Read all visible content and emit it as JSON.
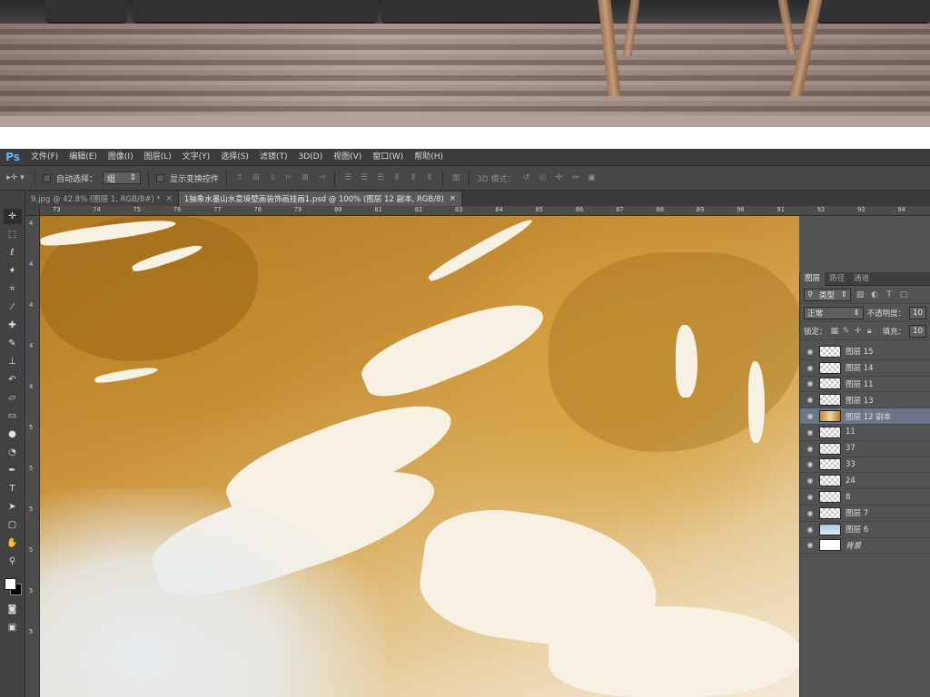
{
  "app": {
    "logo": "Ps",
    "menu": [
      "文件(F)",
      "编辑(E)",
      "图像(I)",
      "图层(L)",
      "文字(Y)",
      "选择(S)",
      "滤镜(T)",
      "3D(D)",
      "视图(V)",
      "窗口(W)",
      "帮助(H)"
    ]
  },
  "options_bar": {
    "auto_select_label": "自动选择：",
    "auto_select_value": "组",
    "show_transform_label": "显示变换控件",
    "mode_3d_label": "3D 模式："
  },
  "tabs": [
    {
      "label": "9.jpg @ 42.8% (图层 1, RGB/8#) *",
      "close": "×"
    },
    {
      "label": "1抽象水墨山水意境壁画装饰画挂画1.psd @ 100% (图层 12 副本, RGB/8)",
      "close": "×"
    }
  ],
  "ruler": {
    "h_labels": [
      "73",
      "74",
      "75",
      "76",
      "77",
      "78",
      "79",
      "80",
      "81",
      "82",
      "83",
      "84",
      "85",
      "86",
      "87",
      "88",
      "89",
      "90",
      "91",
      "92",
      "93",
      "94"
    ],
    "v_labels": [
      "4",
      "4",
      "4",
      "4",
      "4",
      "5",
      "5",
      "5",
      "5",
      "5",
      "5"
    ]
  },
  "layers_panel": {
    "tabs": [
      "图层",
      "路径",
      "通道"
    ],
    "filter_label": "类型",
    "blend_mode": "正常",
    "opacity_label": "不透明度：",
    "opacity_value": "10",
    "lock_label": "锁定：",
    "fill_label": "填充：",
    "fill_value": "10",
    "layers": [
      {
        "name": "图层 15",
        "thumb": "checker",
        "active": false
      },
      {
        "name": "图层 14",
        "thumb": "checker",
        "active": false
      },
      {
        "name": "图层 11",
        "thumb": "checker",
        "active": false
      },
      {
        "name": "图层 13",
        "thumb": "checker",
        "active": false
      },
      {
        "name": "图层 12 副本",
        "thumb": "mountain",
        "active": true
      },
      {
        "name": "11",
        "thumb": "checker",
        "active": false
      },
      {
        "name": "37",
        "thumb": "checker",
        "active": false
      },
      {
        "name": "33",
        "thumb": "checker",
        "active": false
      },
      {
        "name": "24",
        "thumb": "checker",
        "active": false
      },
      {
        "name": "8",
        "thumb": "checker",
        "active": false
      },
      {
        "name": "图层 7",
        "thumb": "checker",
        "active": false
      },
      {
        "name": "图层 6",
        "thumb": "sky",
        "active": false
      },
      {
        "name": "背景",
        "thumb": "white",
        "active": false
      }
    ]
  },
  "tools": [
    "move-tool",
    "marquee-tool",
    "lasso-tool",
    "quick-select-tool",
    "crop-tool",
    "eyedropper-tool",
    "healing-brush-tool",
    "brush-tool",
    "clone-stamp-tool",
    "history-brush-tool",
    "eraser-tool",
    "gradient-tool",
    "blur-tool",
    "dodge-tool",
    "pen-tool",
    "type-tool",
    "path-select-tool",
    "shape-tool",
    "hand-tool",
    "zoom-tool"
  ]
}
